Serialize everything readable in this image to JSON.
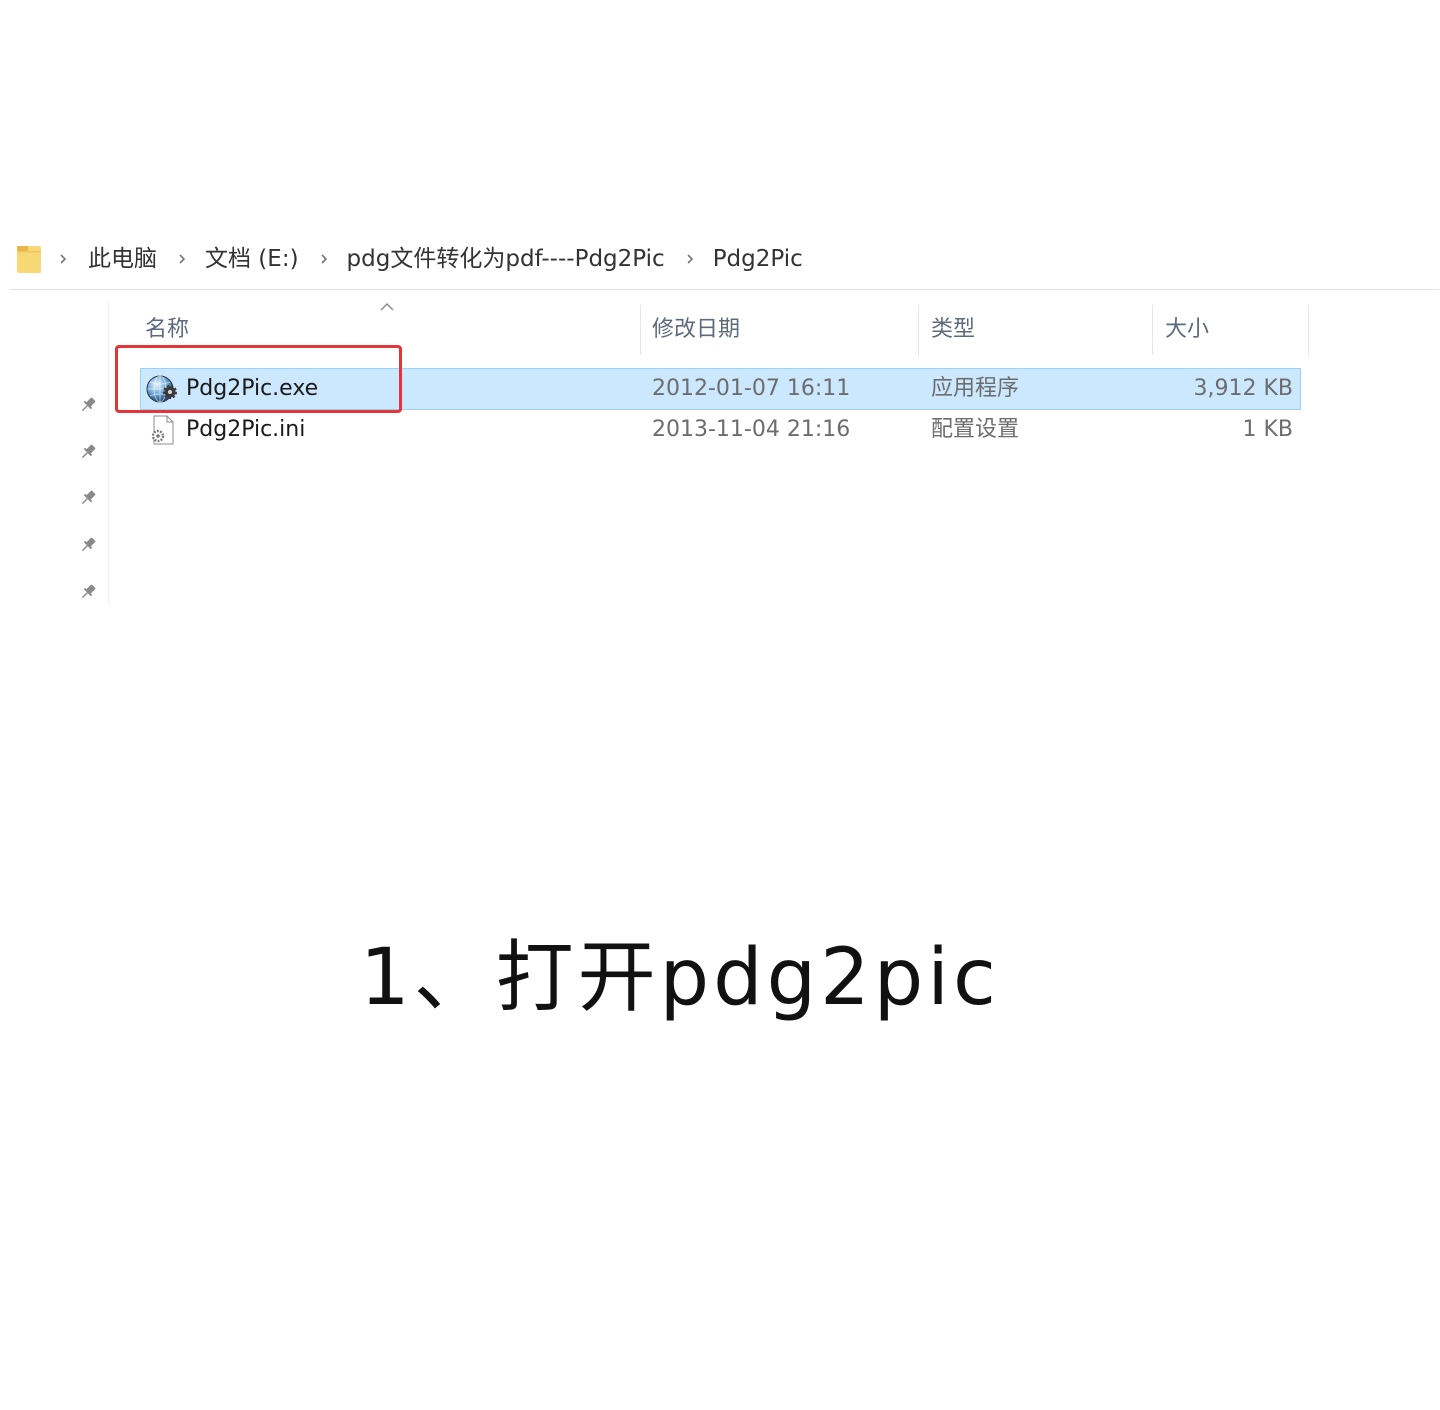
{
  "breadcrumb": {
    "folder_icon": "folder-icon",
    "separator_icon": "chevron-right-icon",
    "items": [
      {
        "label": "此电脑"
      },
      {
        "label": "文档 (E:)"
      },
      {
        "label": "pdg文件转化为pdf----Pdg2Pic"
      },
      {
        "label": "Pdg2Pic"
      }
    ]
  },
  "navigation_pane": {
    "pin_icon": "pin-icon"
  },
  "columns": {
    "name": "名称",
    "date_modified": "修改日期",
    "type": "类型",
    "size": "大小",
    "sort_icon": "sort-ascending-icon"
  },
  "files": [
    {
      "name": "Pdg2Pic.exe",
      "date_modified": "2012-01-07 16:11",
      "type": "应用程序",
      "size": "3,912 KB",
      "icon": "application-exe-icon",
      "selected": true
    },
    {
      "name": "Pdg2Pic.ini",
      "date_modified": "2013-11-04 21:16",
      "type": "配置设置",
      "size": "1 KB",
      "icon": "config-settings-file-icon",
      "selected": false
    }
  ],
  "annotation": {
    "caption": "1、打开pdg2pic"
  },
  "colors": {
    "selection_fill": "#cce8ff",
    "selection_border": "#99d1ff",
    "highlight_box": "#e5343a",
    "folder": "#f8d775"
  }
}
